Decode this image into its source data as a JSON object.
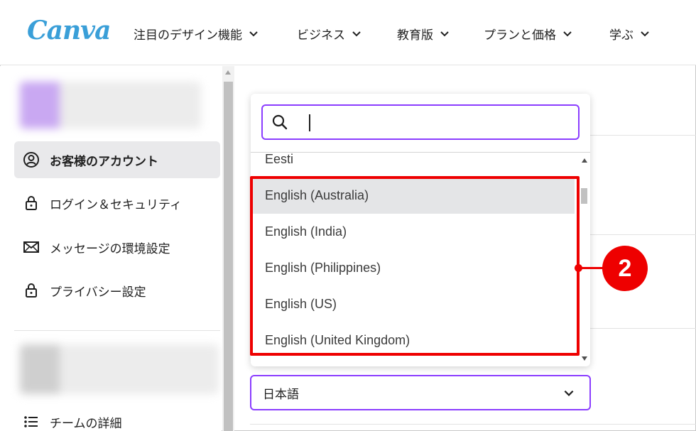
{
  "header": {
    "logo": "Canva",
    "nav": [
      {
        "label": "注目のデザイン機能"
      },
      {
        "label": "ビジネス"
      },
      {
        "label": "教育版"
      },
      {
        "label": "プランと価格"
      },
      {
        "label": "学ぶ"
      }
    ]
  },
  "sidebar": {
    "items": [
      {
        "label": "お客様のアカウント",
        "icon": "user-circle-icon",
        "active": true
      },
      {
        "label": "ログイン＆セキュリティ",
        "icon": "lock-icon"
      },
      {
        "label": "メッセージの環境設定",
        "icon": "mail-icon"
      },
      {
        "label": "プライバシー設定",
        "icon": "lock-icon"
      }
    ],
    "team_item": {
      "label": "チームの詳細",
      "icon": "list-icon"
    }
  },
  "dropdown": {
    "search": {
      "value": "",
      "placeholder": ""
    },
    "options": [
      "Eesti",
      "English (Australia)",
      "English (India)",
      "English (Philippines)",
      "English (US)",
      "English (United Kingdom)"
    ],
    "hovered": "English (Australia)"
  },
  "annotation": {
    "badge": "2",
    "color": "#ee0000"
  },
  "language_select": {
    "value": "日本語"
  },
  "colors": {
    "accent": "#8b3dff",
    "highlight": "#ee0000",
    "hover": "#e4e5e7"
  }
}
